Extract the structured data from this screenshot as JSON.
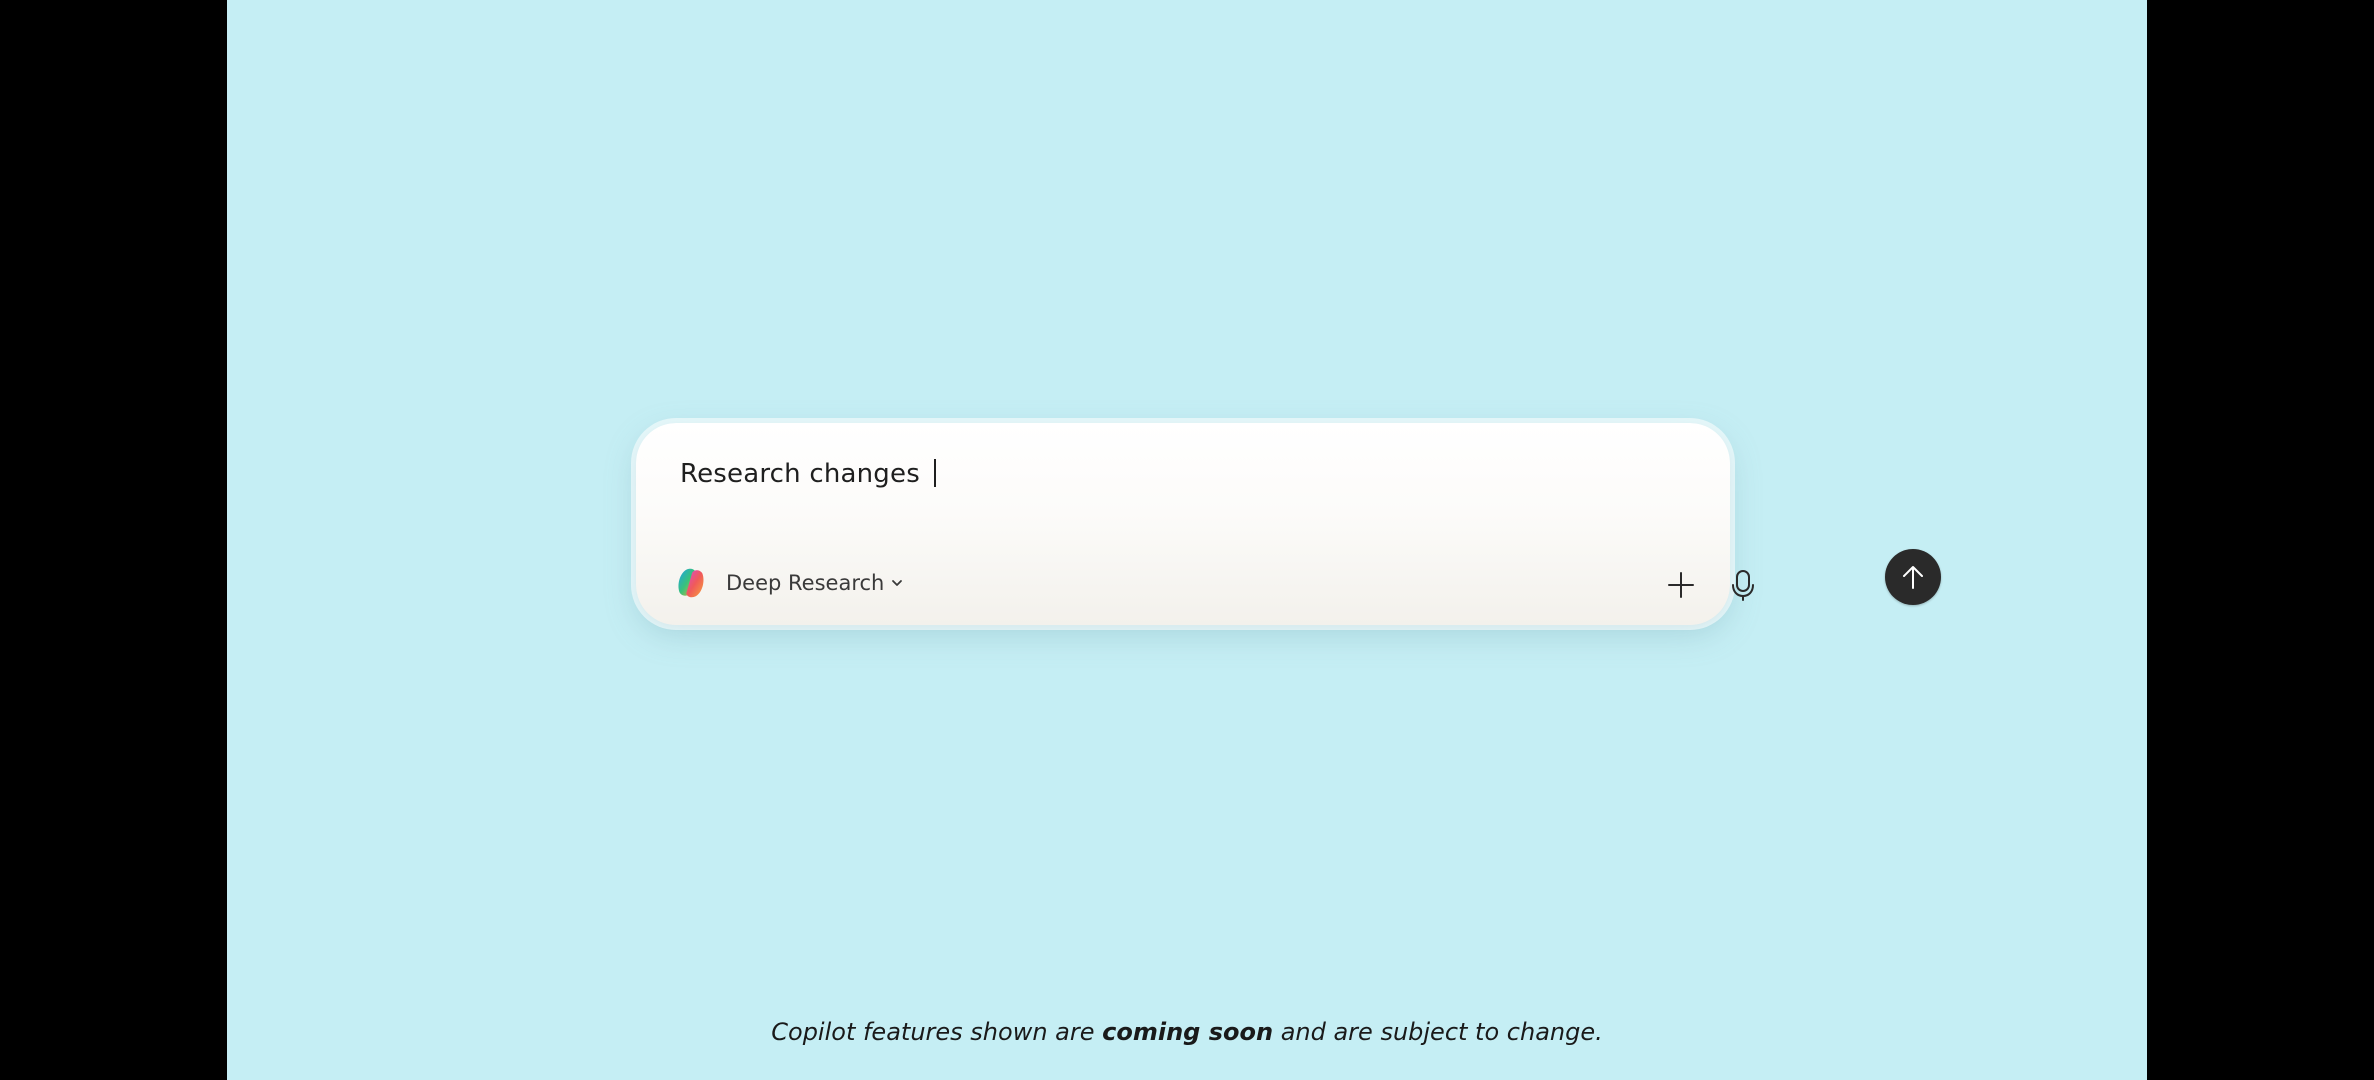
{
  "composer": {
    "input_value": "Research changes ",
    "mode_label": "Deep Research"
  },
  "icons": {
    "logo": "copilot-logo-icon",
    "mode_dropdown": "chevron-down-icon",
    "add": "plus-icon",
    "mic": "microphone-icon",
    "send": "arrow-up-icon"
  },
  "disclaimer": {
    "prefix": "Copilot features shown are ",
    "emphasis": "coming soon",
    "suffix": " and are subject to change."
  },
  "colors": {
    "background": "#c5eef4",
    "send_button": "#2a2a2a"
  }
}
